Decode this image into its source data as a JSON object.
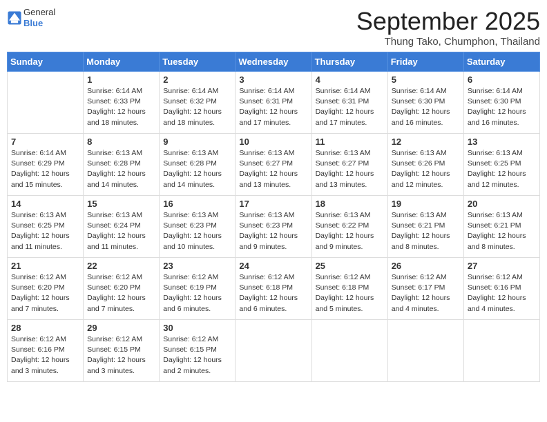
{
  "logo": {
    "general": "General",
    "blue": "Blue"
  },
  "title": "September 2025",
  "location": "Thung Tako, Chumphon, Thailand",
  "days_of_week": [
    "Sunday",
    "Monday",
    "Tuesday",
    "Wednesday",
    "Thursday",
    "Friday",
    "Saturday"
  ],
  "weeks": [
    [
      {
        "day": "",
        "info": ""
      },
      {
        "day": "1",
        "info": "Sunrise: 6:14 AM\nSunset: 6:33 PM\nDaylight: 12 hours\nand 18 minutes."
      },
      {
        "day": "2",
        "info": "Sunrise: 6:14 AM\nSunset: 6:32 PM\nDaylight: 12 hours\nand 18 minutes."
      },
      {
        "day": "3",
        "info": "Sunrise: 6:14 AM\nSunset: 6:31 PM\nDaylight: 12 hours\nand 17 minutes."
      },
      {
        "day": "4",
        "info": "Sunrise: 6:14 AM\nSunset: 6:31 PM\nDaylight: 12 hours\nand 17 minutes."
      },
      {
        "day": "5",
        "info": "Sunrise: 6:14 AM\nSunset: 6:30 PM\nDaylight: 12 hours\nand 16 minutes."
      },
      {
        "day": "6",
        "info": "Sunrise: 6:14 AM\nSunset: 6:30 PM\nDaylight: 12 hours\nand 16 minutes."
      }
    ],
    [
      {
        "day": "7",
        "info": "Sunrise: 6:14 AM\nSunset: 6:29 PM\nDaylight: 12 hours\nand 15 minutes."
      },
      {
        "day": "8",
        "info": "Sunrise: 6:13 AM\nSunset: 6:28 PM\nDaylight: 12 hours\nand 14 minutes."
      },
      {
        "day": "9",
        "info": "Sunrise: 6:13 AM\nSunset: 6:28 PM\nDaylight: 12 hours\nand 14 minutes."
      },
      {
        "day": "10",
        "info": "Sunrise: 6:13 AM\nSunset: 6:27 PM\nDaylight: 12 hours\nand 13 minutes."
      },
      {
        "day": "11",
        "info": "Sunrise: 6:13 AM\nSunset: 6:27 PM\nDaylight: 12 hours\nand 13 minutes."
      },
      {
        "day": "12",
        "info": "Sunrise: 6:13 AM\nSunset: 6:26 PM\nDaylight: 12 hours\nand 12 minutes."
      },
      {
        "day": "13",
        "info": "Sunrise: 6:13 AM\nSunset: 6:25 PM\nDaylight: 12 hours\nand 12 minutes."
      }
    ],
    [
      {
        "day": "14",
        "info": "Sunrise: 6:13 AM\nSunset: 6:25 PM\nDaylight: 12 hours\nand 11 minutes."
      },
      {
        "day": "15",
        "info": "Sunrise: 6:13 AM\nSunset: 6:24 PM\nDaylight: 12 hours\nand 11 minutes."
      },
      {
        "day": "16",
        "info": "Sunrise: 6:13 AM\nSunset: 6:23 PM\nDaylight: 12 hours\nand 10 minutes."
      },
      {
        "day": "17",
        "info": "Sunrise: 6:13 AM\nSunset: 6:23 PM\nDaylight: 12 hours\nand 9 minutes."
      },
      {
        "day": "18",
        "info": "Sunrise: 6:13 AM\nSunset: 6:22 PM\nDaylight: 12 hours\nand 9 minutes."
      },
      {
        "day": "19",
        "info": "Sunrise: 6:13 AM\nSunset: 6:21 PM\nDaylight: 12 hours\nand 8 minutes."
      },
      {
        "day": "20",
        "info": "Sunrise: 6:13 AM\nSunset: 6:21 PM\nDaylight: 12 hours\nand 8 minutes."
      }
    ],
    [
      {
        "day": "21",
        "info": "Sunrise: 6:12 AM\nSunset: 6:20 PM\nDaylight: 12 hours\nand 7 minutes."
      },
      {
        "day": "22",
        "info": "Sunrise: 6:12 AM\nSunset: 6:20 PM\nDaylight: 12 hours\nand 7 minutes."
      },
      {
        "day": "23",
        "info": "Sunrise: 6:12 AM\nSunset: 6:19 PM\nDaylight: 12 hours\nand 6 minutes."
      },
      {
        "day": "24",
        "info": "Sunrise: 6:12 AM\nSunset: 6:18 PM\nDaylight: 12 hours\nand 6 minutes."
      },
      {
        "day": "25",
        "info": "Sunrise: 6:12 AM\nSunset: 6:18 PM\nDaylight: 12 hours\nand 5 minutes."
      },
      {
        "day": "26",
        "info": "Sunrise: 6:12 AM\nSunset: 6:17 PM\nDaylight: 12 hours\nand 4 minutes."
      },
      {
        "day": "27",
        "info": "Sunrise: 6:12 AM\nSunset: 6:16 PM\nDaylight: 12 hours\nand 4 minutes."
      }
    ],
    [
      {
        "day": "28",
        "info": "Sunrise: 6:12 AM\nSunset: 6:16 PM\nDaylight: 12 hours\nand 3 minutes."
      },
      {
        "day": "29",
        "info": "Sunrise: 6:12 AM\nSunset: 6:15 PM\nDaylight: 12 hours\nand 3 minutes."
      },
      {
        "day": "30",
        "info": "Sunrise: 6:12 AM\nSunset: 6:15 PM\nDaylight: 12 hours\nand 2 minutes."
      },
      {
        "day": "",
        "info": ""
      },
      {
        "day": "",
        "info": ""
      },
      {
        "day": "",
        "info": ""
      },
      {
        "day": "",
        "info": ""
      }
    ]
  ]
}
